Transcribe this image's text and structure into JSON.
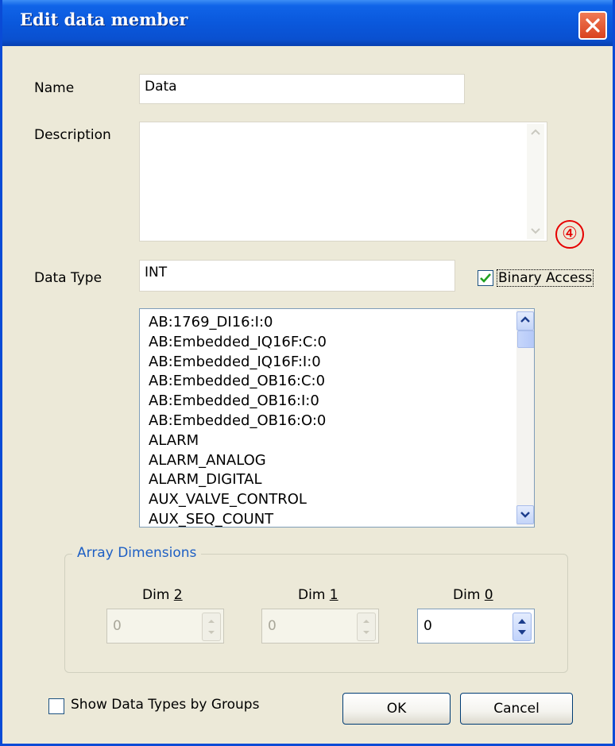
{
  "window": {
    "title": "Edit data member"
  },
  "name": {
    "label": "Name",
    "value": "Data"
  },
  "description": {
    "label": "Description",
    "value": ""
  },
  "annotation": {
    "marker": "④"
  },
  "data_type": {
    "label": "Data Type",
    "value": "INT"
  },
  "binary_access": {
    "label": "Binary Access",
    "checked": true
  },
  "type_list": {
    "items": [
      "AB:1769_DI16:I:0",
      "AB:Embedded_IQ16F:C:0",
      "AB:Embedded_IQ16F:I:0",
      "AB:Embedded_OB16:C:0",
      "AB:Embedded_OB16:I:0",
      "AB:Embedded_OB16:O:0",
      "ALARM",
      "ALARM_ANALOG",
      "ALARM_DIGITAL",
      "AUX_VALVE_CONTROL",
      "AUX_SEQ_COUNT"
    ]
  },
  "array_dimensions": {
    "label": "Array Dimensions",
    "dims": [
      {
        "label_prefix": "Dim ",
        "label_num": "2",
        "value": "0",
        "enabled": false
      },
      {
        "label_prefix": "Dim ",
        "label_num": "1",
        "value": "0",
        "enabled": false
      },
      {
        "label_prefix": "Dim ",
        "label_num": "0",
        "value": "0",
        "enabled": true
      }
    ]
  },
  "show_groups": {
    "label": "Show Data Types by Groups",
    "checked": false
  },
  "buttons": {
    "ok": "OK",
    "cancel": "Cancel"
  },
  "colors": {
    "title_bar": "#0a58dc",
    "dialog_bg": "#ece9d8",
    "group_label": "#1d5fc4",
    "annotation": "#e60000"
  },
  "icons": {
    "close": "close-icon",
    "check": "checkmark-icon",
    "scroll_up": "chevron-up-icon",
    "scroll_down": "chevron-down-icon",
    "spin": "spin-arrows-icon"
  }
}
